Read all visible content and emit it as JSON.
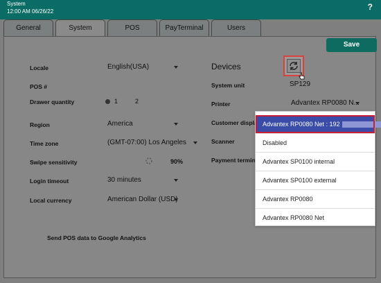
{
  "header": {
    "title": "System",
    "datetime": "12:00 AM 06/26/22",
    "help_label": "?"
  },
  "tabs": [
    {
      "label": "General"
    },
    {
      "label": "System"
    },
    {
      "label": "POS"
    },
    {
      "label": "PayTerminal"
    },
    {
      "label": "Users"
    }
  ],
  "save_label": "Save",
  "settings": {
    "locale": {
      "label": "Locale",
      "value": "English(USA)"
    },
    "pos_number": {
      "label": "POS #"
    },
    "drawer_quantity": {
      "label": "Drawer quantity",
      "option1": "1",
      "option2": "2"
    },
    "region": {
      "label": "Region",
      "value": "America"
    },
    "time_zone": {
      "label": "Time zone",
      "value": "(GMT-07:00) Los Angeles"
    },
    "swipe_sensitivity": {
      "label": "Swipe sensitivity",
      "value": "90%"
    },
    "login_timeout": {
      "label": "Login timeout",
      "value": "30 minutes"
    },
    "local_currency": {
      "label": "Local currency",
      "value": "American Dollar (USD)"
    },
    "google_analytics": {
      "label": "Send POS data to Google Analytics"
    }
  },
  "devices": {
    "title": "Devices",
    "system_unit": {
      "label": "System unit",
      "value": "SP129"
    },
    "printer": {
      "label": "Printer",
      "value": "Advantex RP0080 N..."
    },
    "customer_display": {
      "label": "Customer displa"
    },
    "scanner": {
      "label": "Scanner"
    },
    "payment_terminal": {
      "label": "Payment termin"
    }
  },
  "printer_dropdown": {
    "options": [
      "Advantex RP0080 Net : 192",
      "Disabled",
      "Advantex SP0100 internal",
      "Advantex SP0100 external",
      "Advantex RP0080",
      "Advantex RP0080 Net"
    ],
    "selected": "Advantex RP0080 Net : 192"
  },
  "colors": {
    "titlebar": "#0a6c65",
    "save": "#0d6b60",
    "highlight": "#3a4ca8",
    "focus_border": "#c81d35"
  }
}
